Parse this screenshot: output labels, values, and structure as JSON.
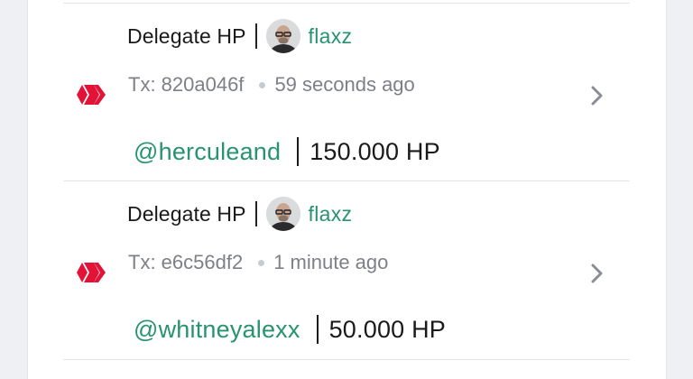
{
  "colors": {
    "accent_green": "#27946e",
    "hive_red": "#e31337",
    "muted_text": "#7d8087"
  },
  "transactions": [
    {
      "icon": "hive-logo",
      "operation": "Delegate HP",
      "author": "flaxz",
      "tx_label": "Tx: 820a046f",
      "time_ago": "59 seconds ago",
      "delegatee": "@herculeand",
      "amount": "150.000 HP"
    },
    {
      "icon": "hive-logo",
      "operation": "Delegate HP",
      "author": "flaxz",
      "tx_label": "Tx: e6c56df2",
      "time_ago": "1 minute ago",
      "delegatee": "@whitneyalexx",
      "amount": "50.000 HP"
    }
  ]
}
